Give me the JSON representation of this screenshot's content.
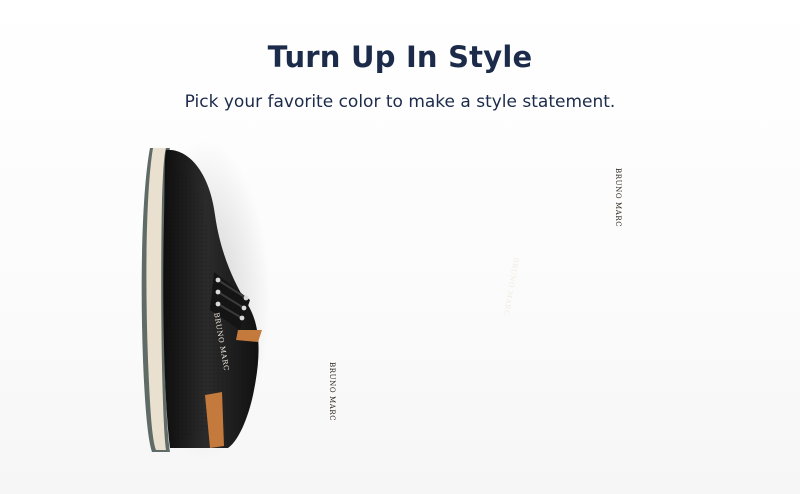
{
  "banner": {
    "title": "Turn Up In Style",
    "subtitle": "Pick your favorite color to make a style statement."
  },
  "colors": {
    "heading": "#1c2b4a",
    "black_shoe": "#1b1b1b",
    "brown_shoe": "#8a4a26",
    "navy_shoe": "#1f2d4b",
    "tan_shoe": "#b8743a",
    "accent_tan": "#c98444"
  },
  "shoes": [
    {
      "color_name": "black",
      "brand_text": "BRUNO MARC"
    },
    {
      "color_name": "brown",
      "brand_text": "BRUNO MARC"
    },
    {
      "color_name": "navy",
      "brand_text": "BRUNO MARC"
    },
    {
      "color_name": "tan",
      "brand_text": "BRUNO MARC"
    }
  ]
}
